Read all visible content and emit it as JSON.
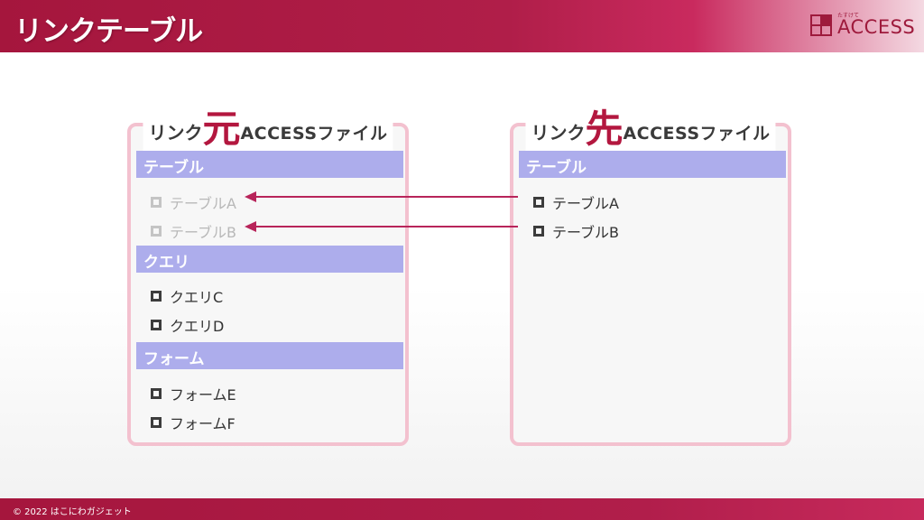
{
  "header": {
    "title": "リンクテーブル"
  },
  "logo": {
    "small": "たすけて",
    "text": "ACCESS"
  },
  "source_panel": {
    "title_prefix": "リンク",
    "title_big": "元",
    "title_suffix": "ACCESSファイル",
    "sections": [
      {
        "label": "テーブル",
        "items": [
          "テーブルA",
          "テーブルB"
        ]
      },
      {
        "label": "クエリ",
        "items": [
          "クエリC",
          "クエリD"
        ]
      },
      {
        "label": "フォーム",
        "items": [
          "フォームE",
          "フォームF"
        ]
      }
    ]
  },
  "target_panel": {
    "title_prefix": "リンク",
    "title_big": "先",
    "title_suffix": "ACCESSファイル",
    "sections": [
      {
        "label": "テーブル",
        "items": [
          "テーブルA",
          "テーブルB"
        ]
      }
    ]
  },
  "colors": {
    "accent": "#b3173f",
    "section_bg": "#adadec",
    "panel_border": "#f3c1cf"
  },
  "footer": {
    "copyright": "© 2022 はこにわガジェット"
  }
}
